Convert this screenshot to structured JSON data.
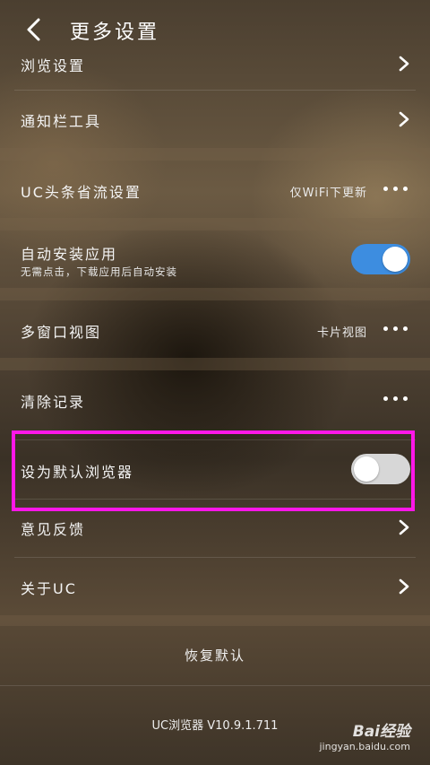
{
  "header": {
    "title": "更多设置"
  },
  "rows": {
    "browse": {
      "label": "浏览设置"
    },
    "notify": {
      "label": "通知栏工具"
    },
    "uc_headline": {
      "label": "UC头条省流设置",
      "value": "仅WiFi下更新"
    },
    "auto_install": {
      "label": "自动安装应用",
      "sub": "无需点击，下载应用后自动安装",
      "toggle": "on"
    },
    "multi_window": {
      "label": "多窗口视图",
      "value": "卡片视图"
    },
    "clear": {
      "label": "清除记录"
    },
    "default_browser": {
      "label": "设为默认浏览器",
      "toggle": "off"
    },
    "feedback": {
      "label": "意见反馈"
    },
    "about": {
      "label": "关于UC"
    }
  },
  "restore_label": "恢复默认",
  "version": "UC浏览器 V10.9.1.711",
  "watermark": {
    "brand": "Bai经验",
    "url": "jingyan.baidu.com"
  },
  "colors": {
    "toggle_on": "#3d8de0",
    "highlight": "#ff17e8"
  }
}
